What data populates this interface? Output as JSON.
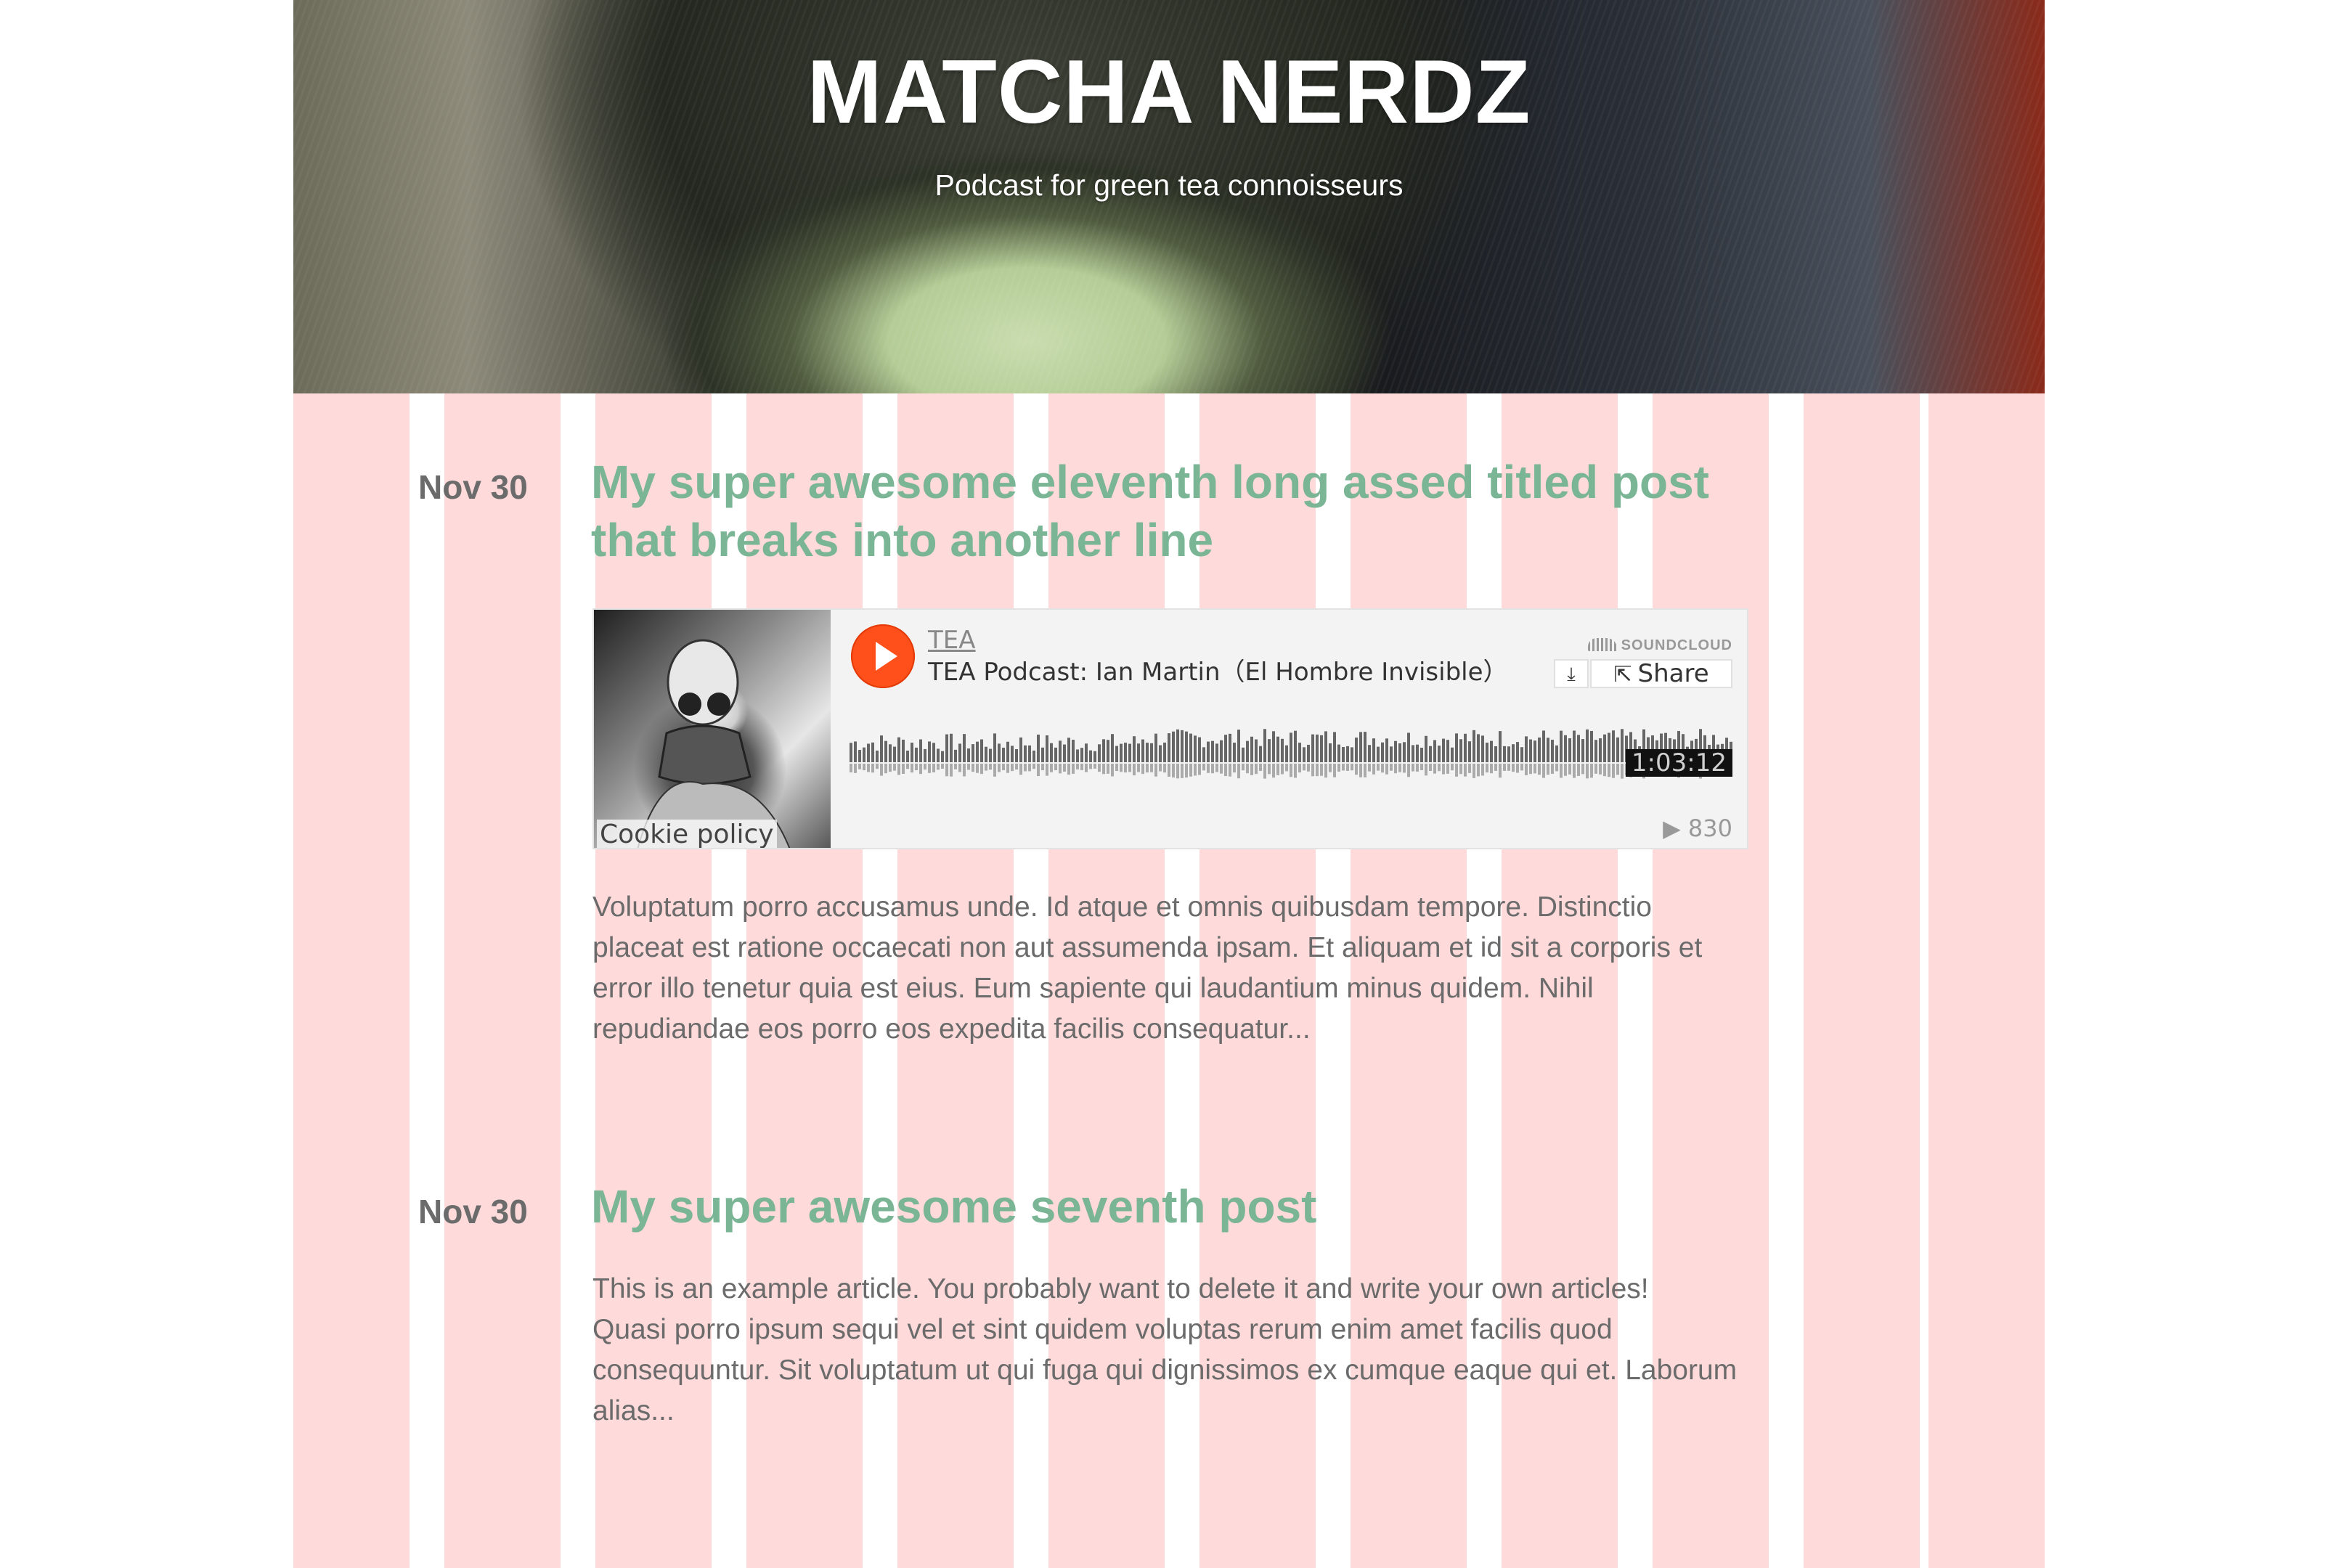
{
  "site": {
    "title": "MATCHA NERDZ",
    "tagline": "Podcast for green tea connoisseurs"
  },
  "posts": [
    {
      "date": "Nov 30",
      "title": "My super awesome eleventh long assed titled post that breaks into another line",
      "excerpt": [
        "Voluptatum porro accusamus unde. Id atque et omnis quibusdam tempore. Distinctio placeat est ratione occaecati non aut assumenda ipsam. Et aliquam et id sit a corporis et error illo tenetur quia est eius. Eum sapiente qui laudantium minus quidem. Nihil repudiandae eos porro eos expedita facilis consequatur..."
      ]
    },
    {
      "date": "Nov 30",
      "title": "My super awesome seventh post",
      "excerpt": [
        "This is an example article. You probably want to delete it and write your own articles!",
        "Quasi porro ipsum sequi vel et sint quidem voluptas rerum enim amet facilis quod consequuntur. Sit voluptatum ut qui fuga qui dignissimos ex cumque eaque qui et. Laborum alias..."
      ]
    }
  ],
  "player": {
    "user": "TEA",
    "track_title": "TEA Podcast: Ian Martin（El Hombre Invisible）",
    "brand": "SOUNDCLOUD",
    "share_label": "Share",
    "download_icon": "download-icon",
    "share_icon": "share-icon",
    "play_icon": "play-icon",
    "duration": "1:03:12",
    "plays": "▶ 830",
    "cookie_policy": "Cookie policy"
  },
  "colors": {
    "accent": "#7ab595",
    "date_text": "#6b6b6b",
    "grid_column": "#ffdada",
    "soundcloud_orange": "#ff4f1a"
  }
}
